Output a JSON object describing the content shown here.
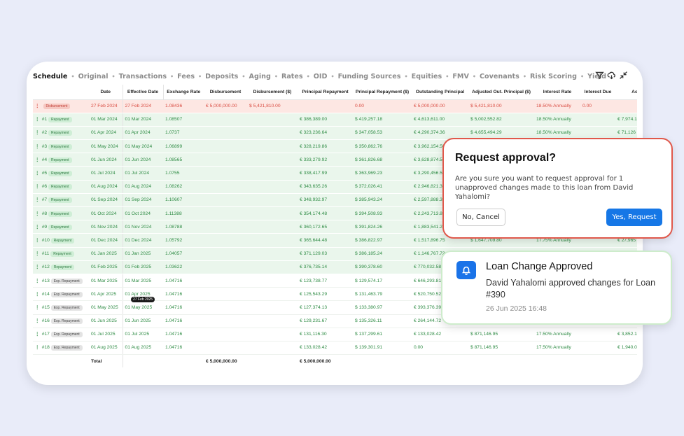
{
  "tabs": [
    "Schedule",
    "Original",
    "Transactions",
    "Fees",
    "Deposits",
    "Aging",
    "Rates",
    "OID",
    "Funding Sources",
    "Equities",
    "FMV",
    "Covenants",
    "Risk Scoring",
    "Yield"
  ],
  "active_tab": "Schedule",
  "table": {
    "columns": [
      "",
      "Date",
      "Effective Date",
      "Exchange Rate",
      "Disbursement",
      "Disbursement ($)",
      "Principal Repayment",
      "Principal Repayment ($)",
      "Outstanding Principal",
      "Adjusted Out. Principal ($)",
      "Interest Rate",
      "Interest Due",
      "Accrued"
    ],
    "rows": [
      {
        "kind": "disb",
        "num": "",
        "type": "Disbursement",
        "date": "27 Feb 2024",
        "eff": "27 Feb 2024",
        "rate": "1.08436",
        "disb": "€ 5,000,000.00",
        "disb_usd": "$ 5,421,810.00",
        "prin": "",
        "prin_usd": "0.00",
        "out": "€ 5,000,000.00",
        "adj": "$ 5,421,810.00",
        "ir": "18.50% Annually",
        "due": "0.00",
        "acc": ""
      },
      {
        "kind": "repay",
        "num": "#1",
        "type": "Repayment",
        "date": "01 Mar 2024",
        "eff": "01 Mar 2024",
        "rate": "1.08507",
        "disb": "",
        "disb_usd": "",
        "prin": "€ 386,389.00",
        "prin_usd": "$ 419,257.18",
        "out": "€ 4,613,611.00",
        "adj": "$ 5,002,552.82",
        "ir": "18.50% Annually",
        "due": "",
        "acc": "€ 7,974.1"
      },
      {
        "kind": "repay",
        "num": "#2",
        "type": "Repayment",
        "date": "01 Apr 2024",
        "eff": "01 Apr 2024",
        "rate": "1.0737",
        "disb": "",
        "disb_usd": "",
        "prin": "€ 323,236.64",
        "prin_usd": "$ 347,058.53",
        "out": "€ 4,290,374.36",
        "adj": "$ 4,655,494.29",
        "ir": "18.50% Annually",
        "due": "",
        "acc": "€ 71,126"
      },
      {
        "kind": "repay",
        "num": "#3",
        "type": "Repayment",
        "date": "01 May 2024",
        "eff": "01 May 2024",
        "rate": "1.06899",
        "disb": "",
        "disb_usd": "",
        "prin": "€ 328,219.86",
        "prin_usd": "$ 350,862.76",
        "out": "€ 3,962,154.50",
        "adj": "",
        "ir": "",
        "due": "",
        "acc": ""
      },
      {
        "kind": "repay",
        "num": "#4",
        "type": "Repayment",
        "date": "01 Jun 2024",
        "eff": "01 Jun 2024",
        "rate": "1.08565",
        "disb": "",
        "disb_usd": "",
        "prin": "€ 333,279.92",
        "prin_usd": "$ 361,826.68",
        "out": "€ 3,628,874.58",
        "adj": "",
        "ir": "",
        "due": "",
        "acc": ""
      },
      {
        "kind": "repay",
        "num": "#5",
        "type": "Repayment",
        "date": "01 Jul 2024",
        "eff": "01 Jul 2024",
        "rate": "1.0755",
        "disb": "",
        "disb_usd": "",
        "prin": "€ 338,417.99",
        "prin_usd": "$ 363,969.23",
        "out": "€ 3,290,456.59",
        "adj": "",
        "ir": "",
        "due": "",
        "acc": ""
      },
      {
        "kind": "repay",
        "num": "#6",
        "type": "Repayment",
        "date": "01 Aug 2024",
        "eff": "01 Aug 2024",
        "rate": "1.08262",
        "disb": "",
        "disb_usd": "",
        "prin": "€ 343,635.26",
        "prin_usd": "$ 372,026.41",
        "out": "€ 2,946,821.33",
        "adj": "",
        "ir": "",
        "due": "",
        "acc": ""
      },
      {
        "kind": "repay",
        "num": "#7",
        "type": "Repayment",
        "date": "01 Sep 2024",
        "eff": "01 Sep 2024",
        "rate": "1.10607",
        "disb": "",
        "disb_usd": "",
        "prin": "€ 348,932.97",
        "prin_usd": "$ 385,943.24",
        "out": "€ 2,597,888.36",
        "adj": "",
        "ir": "",
        "due": "",
        "acc": ""
      },
      {
        "kind": "repay",
        "num": "#8",
        "type": "Repayment",
        "date": "01 Oct 2024",
        "eff": "01 Oct 2024",
        "rate": "1.11388",
        "disb": "",
        "disb_usd": "",
        "prin": "€ 354,174.48",
        "prin_usd": "$ 394,508.93",
        "out": "€ 2,243,713.88",
        "adj": "",
        "ir": "",
        "due": "",
        "acc": ""
      },
      {
        "kind": "repay",
        "num": "#9",
        "type": "Repayment",
        "date": "01 Nov 2024",
        "eff": "01 Nov 2024",
        "rate": "1.08788",
        "disb": "",
        "disb_usd": "",
        "prin": "€ 360,172.65",
        "prin_usd": "$ 391,824.26",
        "out": "€ 1,883,541.23",
        "adj": "",
        "ir": "",
        "due": "",
        "acc": ""
      },
      {
        "kind": "repay",
        "num": "#10",
        "type": "Repayment",
        "date": "01 Dec 2024",
        "eff": "01 Dec 2024",
        "rate": "1.05792",
        "disb": "",
        "disb_usd": "",
        "prin": "€ 365,644.48",
        "prin_usd": "$ 386,822.97",
        "out": "€ 1,517,896.75",
        "adj": "$ 1,647,709.80",
        "ir": "17.75% Annually",
        "due": "",
        "acc": "€ 27,965"
      },
      {
        "kind": "repay",
        "num": "#11",
        "type": "Repayment",
        "date": "01 Jan 2025",
        "eff": "01 Jan 2025",
        "rate": "1.04057",
        "disb": "",
        "disb_usd": "",
        "prin": "€ 371,129.03",
        "prin_usd": "$ 386,185.24",
        "out": "€ 1,146,767.72",
        "adj": "",
        "ir": "",
        "due": "",
        "acc": ""
      },
      {
        "kind": "repay",
        "num": "#12",
        "type": "Repayment",
        "date": "01 Feb 2025",
        "eff": "01 Feb 2025",
        "rate": "1.03622",
        "disb": "",
        "disb_usd": "",
        "prin": "€ 376,735.14",
        "prin_usd": "$ 390,378.60",
        "out": "€ 770,032.58",
        "adj": "",
        "ir": "",
        "due": "",
        "acc": ""
      },
      {
        "kind": "exp",
        "num": "#13",
        "type": "Exp. Repayment",
        "date": "01 Mar 2025",
        "eff": "01 Mar 2025",
        "rate": "1.04716",
        "disb": "",
        "disb_usd": "",
        "prin": "€ 123,738.77",
        "prin_usd": "$ 129,574.17",
        "out": "€ 646,293.81",
        "adj": "",
        "ir": "",
        "due": "",
        "acc": ""
      },
      {
        "kind": "exp",
        "num": "#14",
        "type": "Exp. Repayment",
        "date": "01 Apr 2025",
        "eff": "01 Apr 2025",
        "rate": "1.04716",
        "disb": "",
        "disb_usd": "",
        "prin": "€ 125,543.29",
        "prin_usd": "$ 131,463.79",
        "out": "€ 520,750.52",
        "adj": "",
        "ir": "",
        "due": "",
        "acc": ""
      },
      {
        "kind": "exp",
        "num": "#15",
        "type": "Exp. Repayment",
        "date": "01 May 2025",
        "eff": "01 May 2025",
        "rate": "1.04716",
        "disb": "",
        "disb_usd": "",
        "prin": "€ 127,374.13",
        "prin_usd": "$ 133,380.97",
        "out": "€ 393,376.39",
        "adj": "",
        "ir": "",
        "due": "",
        "acc": ""
      },
      {
        "kind": "exp",
        "num": "#16",
        "type": "Exp. Repayment",
        "date": "01 Jun 2025",
        "eff": "01 Jun 2025",
        "rate": "1.04716",
        "disb": "",
        "disb_usd": "",
        "prin": "€ 129,231.67",
        "prin_usd": "$ 135,326.11",
        "out": "€ 264,144.72",
        "adj": "",
        "ir": "",
        "due": "",
        "acc": ""
      },
      {
        "kind": "exp",
        "num": "#17",
        "type": "Exp. Repayment",
        "date": "01 Jul 2025",
        "eff": "01 Jul 2025",
        "rate": "1.04716",
        "disb": "",
        "disb_usd": "",
        "prin": "€ 131,116.30",
        "prin_usd": "$ 137,299.61",
        "out": "€ 133,028.42",
        "adj": "$ 871,146.95",
        "ir": "17.50% Annually",
        "due": "",
        "acc": "€ 3,852.1"
      },
      {
        "kind": "exp",
        "num": "#18",
        "type": "Exp. Repayment",
        "date": "01 Aug 2025",
        "eff": "01 Aug 2025",
        "rate": "1.04716",
        "disb": "",
        "disb_usd": "",
        "prin": "€ 133,028.42",
        "prin_usd": "$ 139,301.91",
        "out": "0.00",
        "adj": "$ 871,146.95",
        "ir": "17.50% Annually",
        "due": "",
        "acc": "€ 1,940.0"
      }
    ],
    "total": {
      "label": "Total",
      "disb": "€ 5,000,000.00",
      "prin": "€ 5,000,000.00"
    },
    "date_marker": "27 Feb 2025"
  },
  "dialog": {
    "title": "Request approval?",
    "body": "Are you sure you want to request approval for 1 unapproved changes made to this loan from David Yahalomi?",
    "cancel": "No, Cancel",
    "confirm": "Yes, Request"
  },
  "toast": {
    "title": "Loan Change Approved",
    "message": "David Yahalomi approved changes for Loan #390",
    "time": "26 Jun 2025 16:48"
  },
  "colors": {
    "accent": "#1677e6",
    "danger_border": "#e0584b",
    "repay_bg": "#eaf6ec",
    "disb_bg": "#fde7e3"
  }
}
